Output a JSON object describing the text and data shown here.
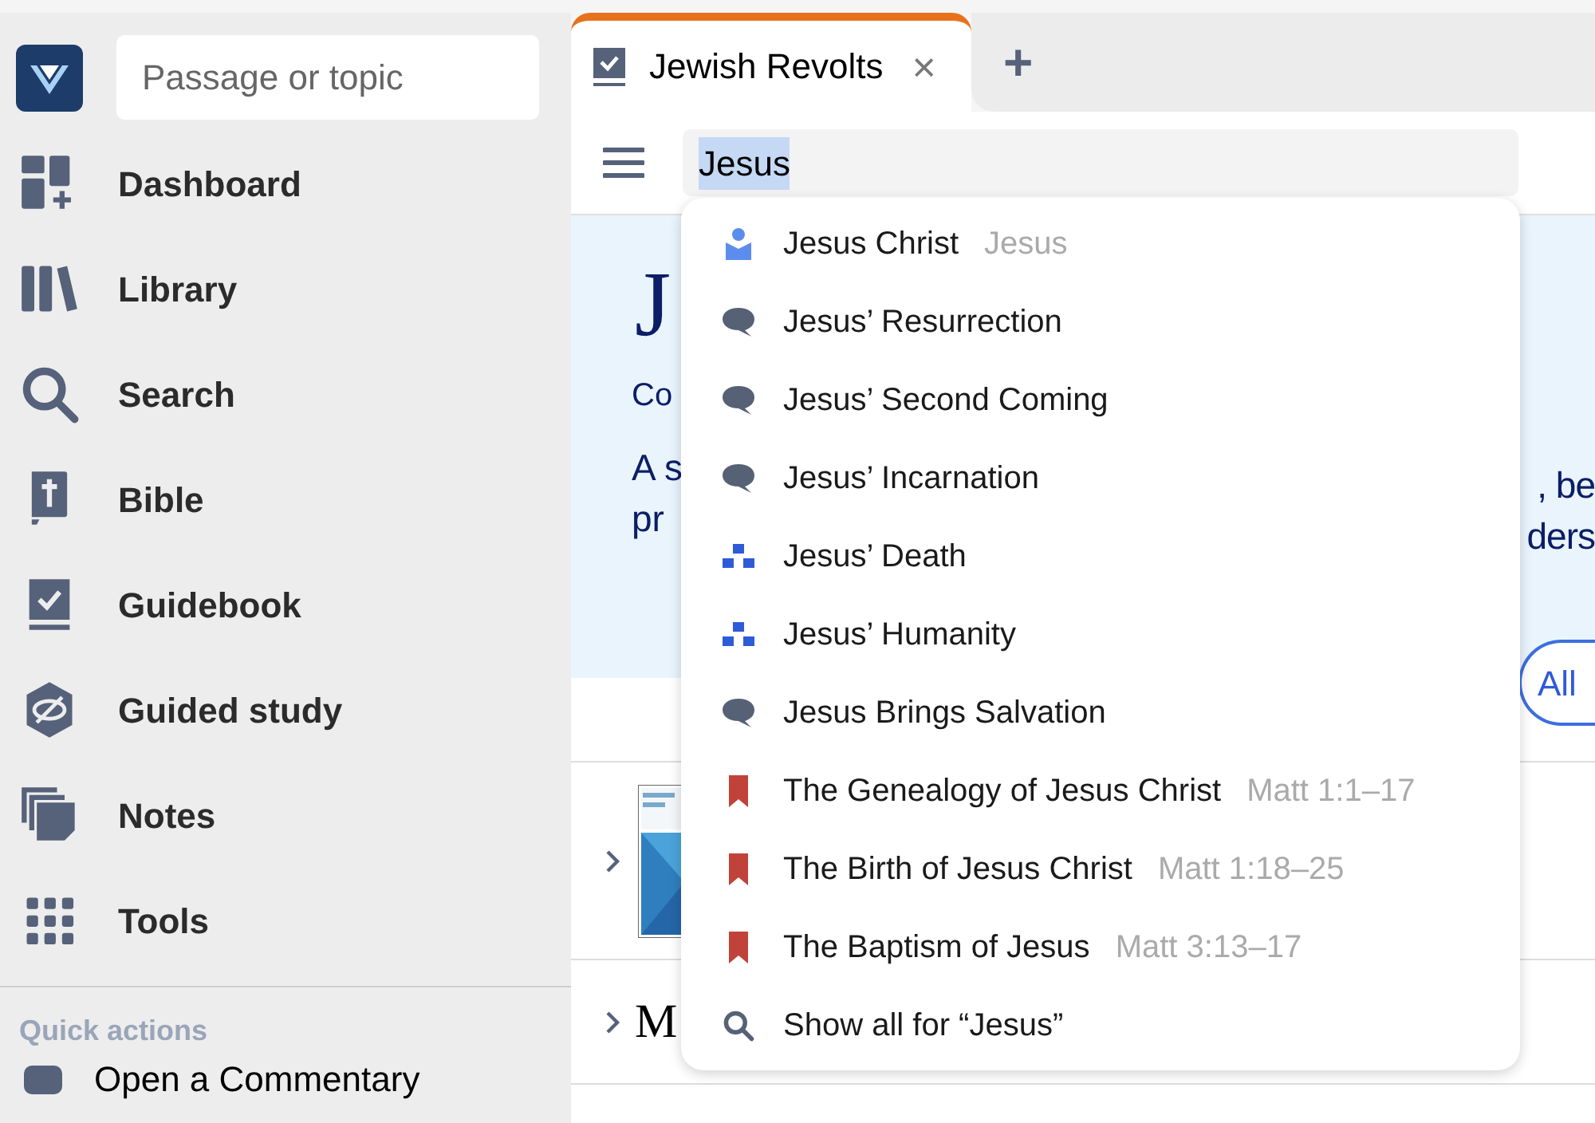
{
  "sidebar": {
    "search": {
      "placeholder": "Passage or topic"
    },
    "items": [
      {
        "label": "Dashboard"
      },
      {
        "label": "Library"
      },
      {
        "label": "Search"
      },
      {
        "label": "Bible"
      },
      {
        "label": "Guidebook"
      },
      {
        "label": "Guided study"
      },
      {
        "label": "Notes"
      },
      {
        "label": "Tools"
      }
    ],
    "quick_actions": {
      "heading": "Quick actions",
      "items": [
        {
          "label": "Open a Commentary"
        }
      ]
    }
  },
  "tabs": [
    {
      "label": "Jewish Revolts",
      "selected": true,
      "close": "×"
    }
  ],
  "new_tab": "+",
  "search": {
    "value": "Jesus",
    "value_selected": true
  },
  "hero": {
    "title": "J",
    "subtitle": "Co",
    "text_left": [
      "A s",
      "pr"
    ],
    "text_right": [
      ", be",
      "ders"
    ],
    "button": "All"
  },
  "results": [
    {
      "kind": "book",
      "expanded": false
    },
    {
      "kind": "heading",
      "title": "M",
      "expanded": false
    }
  ],
  "suggestions": [
    {
      "kind": "person",
      "label": "Jesus Christ",
      "detail": "Jesus"
    },
    {
      "kind": "topic",
      "label": "Jesus’ Resurrection"
    },
    {
      "kind": "topic",
      "label": "Jesus’ Second Coming"
    },
    {
      "kind": "topic",
      "label": "Jesus’ Incarnation"
    },
    {
      "kind": "event",
      "label": "Jesus’ Death"
    },
    {
      "kind": "event",
      "label": "Jesus’ Humanity"
    },
    {
      "kind": "topic",
      "label": "Jesus Brings Salvation"
    },
    {
      "kind": "passage",
      "label": "The Genealogy of Jesus Christ",
      "detail": "Matt 1:1–17"
    },
    {
      "kind": "passage",
      "label": "The Birth of Jesus Christ",
      "detail": "Matt 1:18–25"
    },
    {
      "kind": "passage",
      "label": "The Baptism of Jesus",
      "detail": "Matt 3:13–17"
    },
    {
      "kind": "search",
      "label": "Show all for “Jesus”"
    }
  ]
}
